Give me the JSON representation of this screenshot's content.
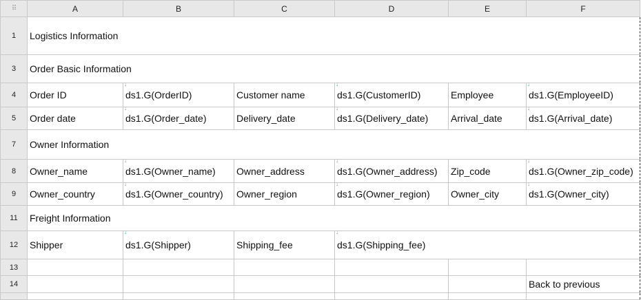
{
  "columns": [
    "A",
    "B",
    "C",
    "D",
    "E",
    "F"
  ],
  "corner_icon": "select-all-grid-icon",
  "rows": [
    {
      "num": "1",
      "h": 55,
      "cells": [
        {
          "text": "Logistics Information",
          "span": 6
        }
      ]
    },
    {
      "num": "3",
      "h": 41,
      "cells": [
        {
          "text": "Order Basic Information",
          "span": 6
        }
      ]
    },
    {
      "num": "4",
      "h": 35,
      "cells": [
        {
          "text": "Order ID"
        },
        {
          "text": "ds1.G(OrderID)",
          "mark": "gray"
        },
        {
          "text": "Customer name"
        },
        {
          "text": "ds1.G(CustomerID)",
          "mark": "teal"
        },
        {
          "text": "Employee"
        },
        {
          "text": "ds1.G(EmployeeID)",
          "mark": "teal"
        }
      ]
    },
    {
      "num": "5",
      "h": 33,
      "cells": [
        {
          "text": "Order date"
        },
        {
          "text": "ds1.G(Order_date)",
          "mark": "gray"
        },
        {
          "text": "Delivery_date"
        },
        {
          "text": "ds1.G(Delivery_date)",
          "mark": "gray"
        },
        {
          "text": "Arrival_date"
        },
        {
          "text": "ds1.G(Arrival_date)",
          "mark": "gray"
        }
      ]
    },
    {
      "num": "7",
      "h": 43,
      "cells": [
        {
          "text": "Owner Information",
          "span": 6
        }
      ]
    },
    {
      "num": "8",
      "h": 34,
      "cells": [
        {
          "text": "Owner_name"
        },
        {
          "text": "ds1.G(Owner_name)",
          "mark": "gray"
        },
        {
          "text": "Owner_address"
        },
        {
          "text": "ds1.G(Owner_address)",
          "mark": "gray"
        },
        {
          "text": "Zip_code"
        },
        {
          "text": "ds1.G(Owner_zip_code)",
          "mark": "gray"
        }
      ]
    },
    {
      "num": "9",
      "h": 33,
      "cells": [
        {
          "text": "Owner_country"
        },
        {
          "text": "ds1.G(Owner_country)",
          "mark": "gray"
        },
        {
          "text": "Owner_region"
        },
        {
          "text": "ds1.G(Owner_region)",
          "mark": "gray"
        },
        {
          "text": "Owner_city"
        },
        {
          "text": "ds1.G(Owner_city)",
          "mark": "gray"
        }
      ]
    },
    {
      "num": "11",
      "h": 37,
      "cells": [
        {
          "text": "Freight Information",
          "span": 6
        }
      ]
    },
    {
      "num": "12",
      "h": 41,
      "cells": [
        {
          "text": "Shipper"
        },
        {
          "text": "ds1.G(Shipper)",
          "mark": "teal"
        },
        {
          "text": "Shipping_fee"
        },
        {
          "text": "ds1.G(Shipping_fee)",
          "mark": "gray",
          "span": 3
        }
      ]
    },
    {
      "num": "13",
      "h": 24,
      "cells": [
        {
          "text": ""
        },
        {
          "text": ""
        },
        {
          "text": ""
        },
        {
          "text": ""
        },
        {
          "text": ""
        },
        {
          "text": ""
        }
      ]
    },
    {
      "num": "14",
      "h": 25,
      "cells": [
        {
          "text": ""
        },
        {
          "text": ""
        },
        {
          "text": ""
        },
        {
          "text": ""
        },
        {
          "text": ""
        },
        {
          "text": "Back to previous",
          "link": true
        }
      ]
    },
    {
      "num": "",
      "h": 10,
      "cells": [
        {
          "text": ""
        },
        {
          "text": ""
        },
        {
          "text": ""
        },
        {
          "text": ""
        },
        {
          "text": ""
        },
        {
          "text": ""
        }
      ]
    }
  ]
}
